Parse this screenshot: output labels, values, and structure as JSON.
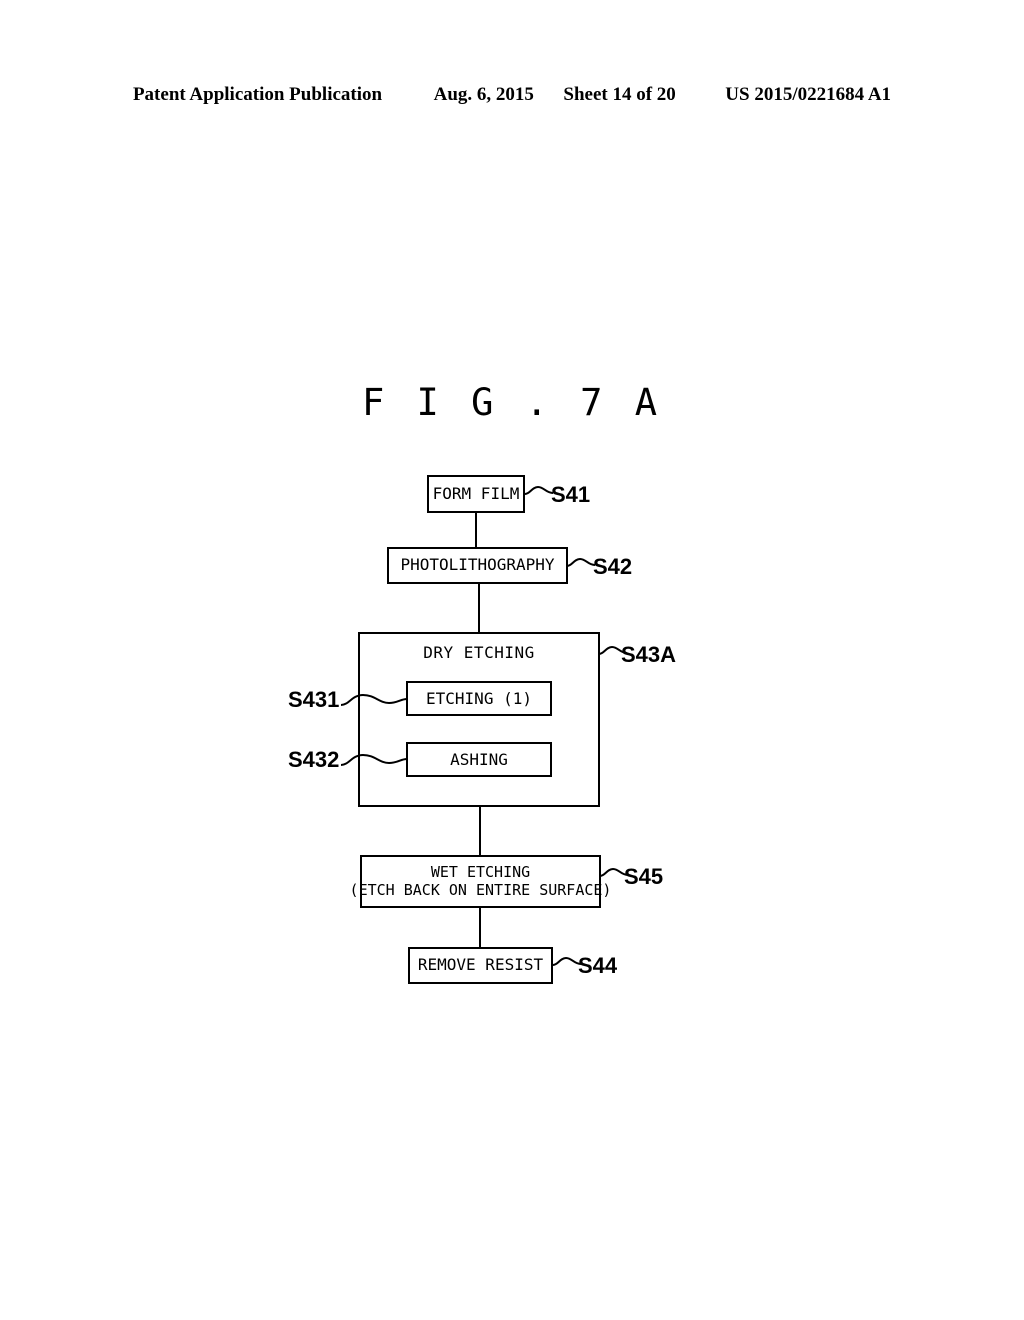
{
  "header": {
    "publication": "Patent Application Publication",
    "date": "Aug. 6, 2015",
    "sheet": "Sheet 14 of 20",
    "patent_number": "US 2015/0221684 A1"
  },
  "figure": {
    "title": "F I G . 7 A"
  },
  "flowchart": {
    "steps": [
      {
        "id": "S41",
        "label": "FORM FILM",
        "ref": "S41"
      },
      {
        "id": "S42",
        "label": "PHOTOLITHOGRAPHY",
        "ref": "S42"
      },
      {
        "id": "S43A",
        "label": "DRY ETCHING",
        "ref": "S43A"
      },
      {
        "id": "S45",
        "label_line1": "WET ETCHING",
        "label_line2": "(ETCH BACK ON ENTIRE SURFACE)",
        "ref": "S45"
      },
      {
        "id": "S44",
        "label": "REMOVE RESIST",
        "ref": "S44"
      }
    ],
    "substeps": [
      {
        "id": "S431",
        "label": "ETCHING (1)",
        "ref": "S431"
      },
      {
        "id": "S432",
        "label": "ASHING",
        "ref": "S432"
      }
    ]
  },
  "colors": {
    "ink": "#000000",
    "paper": "#ffffff"
  }
}
